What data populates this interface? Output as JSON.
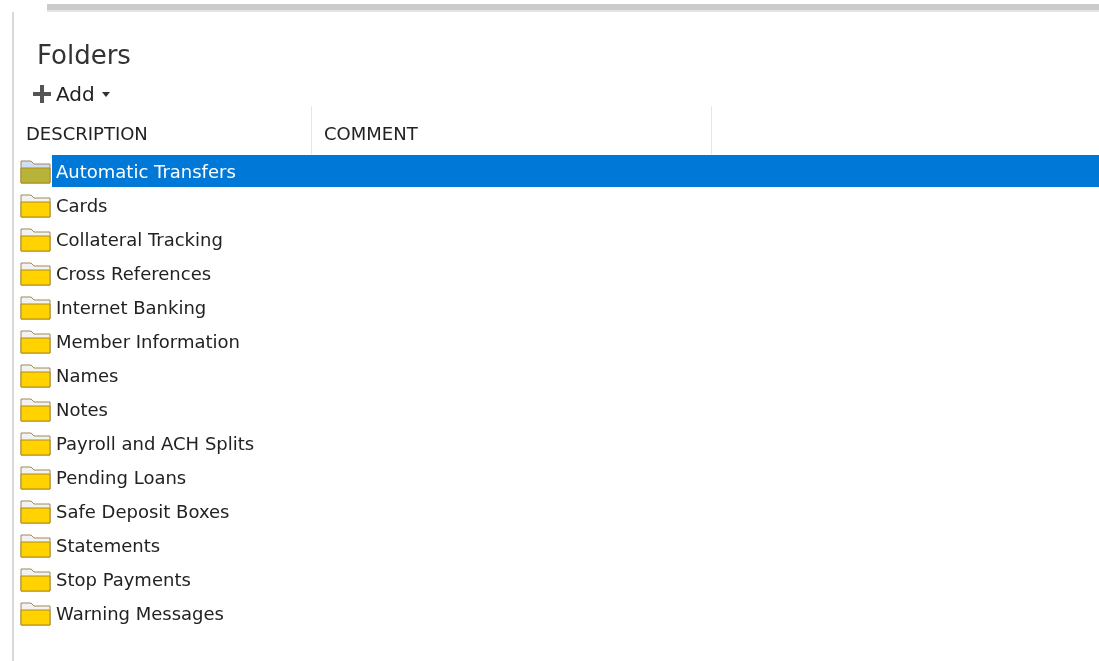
{
  "title": "Folders",
  "toolbar": {
    "add_button": {
      "label": "Add"
    }
  },
  "table": {
    "columns": [
      "DESCRIPTION",
      "COMMENT"
    ],
    "rows": [
      {
        "description": "Automatic Transfers",
        "selected": true
      },
      {
        "description": "Cards",
        "selected": false
      },
      {
        "description": "Collateral Tracking",
        "selected": false
      },
      {
        "description": "Cross References",
        "selected": false
      },
      {
        "description": "Internet Banking",
        "selected": false
      },
      {
        "description": "Member Information",
        "selected": false
      },
      {
        "description": "Names",
        "selected": false
      },
      {
        "description": "Notes",
        "selected": false
      },
      {
        "description": "Payroll and ACH Splits",
        "selected": false
      },
      {
        "description": "Pending Loans",
        "selected": false
      },
      {
        "description": "Safe Deposit Boxes",
        "selected": false
      },
      {
        "description": "Statements",
        "selected": false
      },
      {
        "description": "Stop Payments",
        "selected": false
      },
      {
        "description": "Warning Messages",
        "selected": false
      }
    ]
  }
}
